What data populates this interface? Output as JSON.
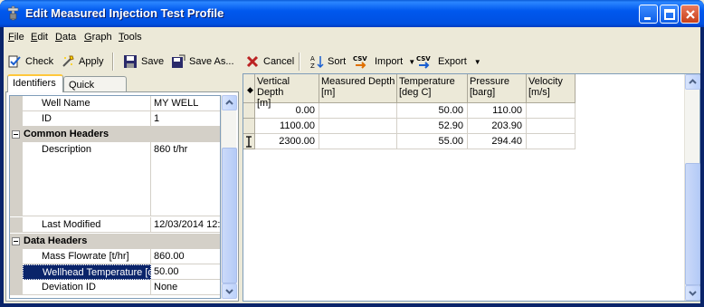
{
  "window": {
    "title": "Edit Measured Injection Test Profile"
  },
  "menu": [
    {
      "label": "File",
      "accel": "F",
      "rest": "ile"
    },
    {
      "label": "Edit",
      "accel": "E",
      "rest": "dit"
    },
    {
      "label": "Data",
      "accel": "D",
      "rest": "ata"
    },
    {
      "label": "Graph",
      "accel": "G",
      "rest": "raph"
    },
    {
      "label": "Tools",
      "accel": "T",
      "rest": "ools"
    }
  ],
  "toolbar": {
    "check": "Check",
    "apply": "Apply",
    "save": "Save",
    "save_as": "Save As...",
    "cancel": "Cancel",
    "sort": "Sort",
    "import": "Import",
    "export": "Export",
    "csv_badge": "CSV"
  },
  "tabs": {
    "identifiers": "Identifiers",
    "quick_graph": "Quick Graph"
  },
  "properties": {
    "well_name": {
      "name": "Well Name",
      "value": "MY WELL"
    },
    "id": {
      "name": "ID",
      "value": "1"
    },
    "common_headers": "Common Headers",
    "description": {
      "name": "Description",
      "value": "860 t/hr"
    },
    "last_modified": {
      "name": "Last Modified",
      "value": "12/03/2014 12:"
    },
    "data_headers": "Data Headers",
    "mass_flowrate": {
      "name": "Mass Flowrate [t/hr]",
      "value": "860.00"
    },
    "wellhead_temperature": {
      "name": "Wellhead Temperature [d",
      "value": "50.00"
    },
    "deviation_id": {
      "name": "Deviation ID",
      "value": "None"
    }
  },
  "table": {
    "select_marker": "◆",
    "columns": [
      {
        "title": "Vertical Depth",
        "unit": "[m]"
      },
      {
        "title": "Measured Depth",
        "unit": "[m]"
      },
      {
        "title": "Temperature",
        "unit": "[deg C]"
      },
      {
        "title": "Pressure",
        "unit": "[barg]"
      },
      {
        "title": "Velocity",
        "unit": "[m/s]"
      }
    ],
    "rows": [
      [
        "0.00",
        "",
        "50.00",
        "110.00",
        ""
      ],
      [
        "1100.00",
        "",
        "52.90",
        "203.90",
        ""
      ],
      [
        "2300.00",
        "",
        "55.00",
        "294.40",
        ""
      ]
    ]
  },
  "colors": {
    "titlebar": "#0058ee",
    "selection": "#0a246a"
  }
}
